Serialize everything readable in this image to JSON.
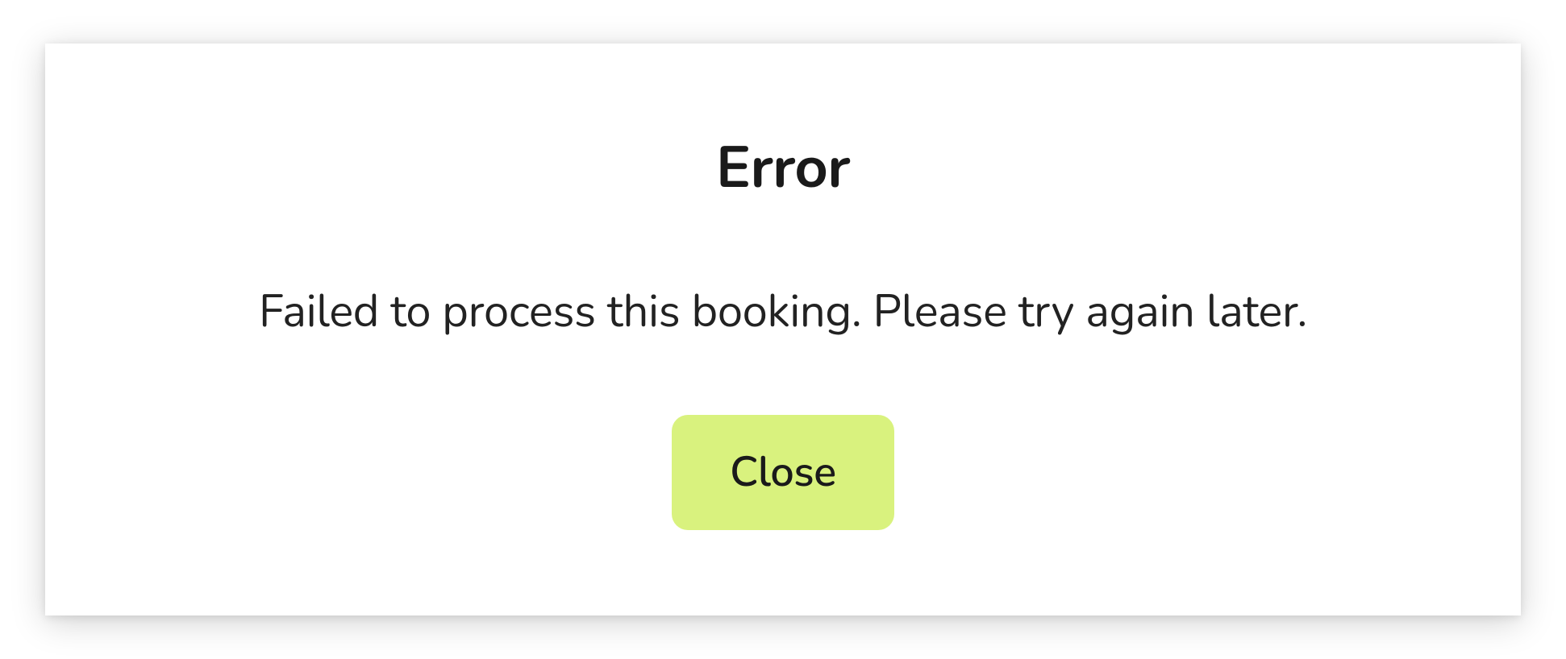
{
  "dialog": {
    "title": "Error",
    "message": "Failed to process this booking. Please try again later.",
    "close_label": "Close"
  }
}
